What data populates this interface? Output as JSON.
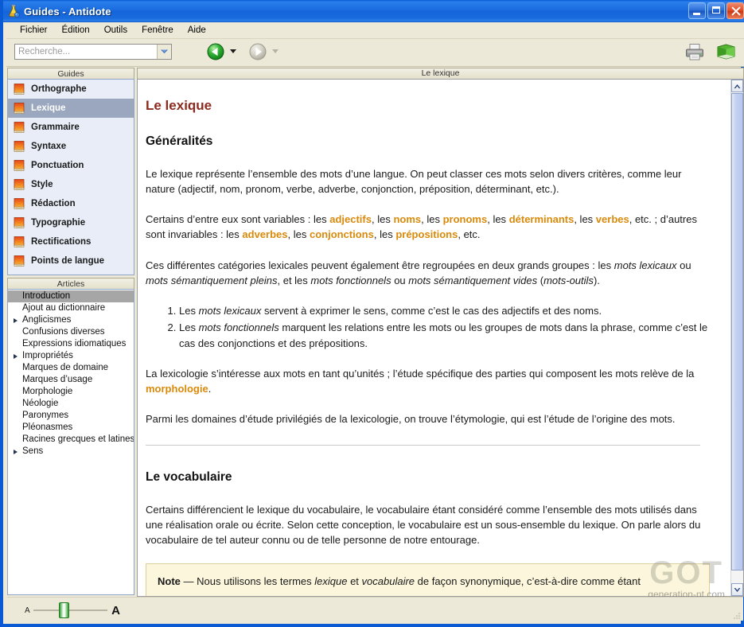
{
  "window": {
    "title": "Guides - Antidote",
    "app_icon": "flask-icon",
    "minimize_label": "Réduire",
    "maximize_label": "Agrandir",
    "close_label": "Fermer"
  },
  "menu": {
    "items": [
      {
        "label": "Fichier"
      },
      {
        "label": "Édition"
      },
      {
        "label": "Outils"
      },
      {
        "label": "Fenêtre"
      },
      {
        "label": "Aide"
      }
    ]
  },
  "toolbar": {
    "search": {
      "value": "",
      "placeholder": "Recherche..."
    },
    "back_icon": "green-back-arrow-icon",
    "forward_icon": "grey-forward-arrow-icon",
    "print_icon": "printer-icon",
    "dictionary_icon": "green-book-icon"
  },
  "sidebar": {
    "guides_header": "Guides",
    "guides": [
      {
        "label": "Orthographe",
        "selected": false
      },
      {
        "label": "Lexique",
        "selected": true
      },
      {
        "label": "Grammaire",
        "selected": false
      },
      {
        "label": "Syntaxe",
        "selected": false
      },
      {
        "label": "Ponctuation",
        "selected": false
      },
      {
        "label": "Style",
        "selected": false
      },
      {
        "label": "Rédaction",
        "selected": false
      },
      {
        "label": "Typographie",
        "selected": false
      },
      {
        "label": "Rectifications",
        "selected": false
      },
      {
        "label": "Points de langue",
        "selected": false
      }
    ],
    "articles_header": "Articles",
    "articles": [
      {
        "label": "Introduction",
        "selected": true,
        "expandable": false
      },
      {
        "label": "Ajout au dictionnaire",
        "selected": false,
        "expandable": false
      },
      {
        "label": "Anglicismes",
        "selected": false,
        "expandable": true
      },
      {
        "label": "Confusions diverses",
        "selected": false,
        "expandable": false
      },
      {
        "label": "Expressions idiomatiques",
        "selected": false,
        "expandable": false
      },
      {
        "label": "Impropriétés",
        "selected": false,
        "expandable": true
      },
      {
        "label": "Marques de domaine",
        "selected": false,
        "expandable": false
      },
      {
        "label": "Marques d’usage",
        "selected": false,
        "expandable": false
      },
      {
        "label": "Morphologie",
        "selected": false,
        "expandable": false
      },
      {
        "label": "Néologie",
        "selected": false,
        "expandable": false
      },
      {
        "label": "Paronymes",
        "selected": false,
        "expandable": false
      },
      {
        "label": "Pléonasmes",
        "selected": false,
        "expandable": false
      },
      {
        "label": "Racines grecques et latines",
        "selected": false,
        "expandable": false
      },
      {
        "label": "Sens",
        "selected": false,
        "expandable": true
      }
    ]
  },
  "content": {
    "tab_title": "Le lexique",
    "title": "Le lexique",
    "section1_heading": "Généralités",
    "p1": "Le lexique représente l’ensemble des mots d’une langue. On peut classer ces mots selon divers critères, comme leur nature (adjectif, nom, pronom, verbe,  adverbe, conjonction, préposition, déterminant, etc.).",
    "p2_parts": {
      "a": "Certains d’entre eux sont variables : les ",
      "kw1": "adjectifs",
      "b": ", les ",
      "kw2": "noms",
      "c": ", les ",
      "kw3": "pronoms",
      "d": ", les ",
      "kw4": "déterminants",
      "e": ", les ",
      "kw5": "verbes",
      "f": ", etc. ; d’autres sont invariables : les ",
      "kw6": "adverbes",
      "g": ", les ",
      "kw7": "conjonctions",
      "h": ", les ",
      "kw8": "prépositions",
      "i": ", etc."
    },
    "p3_parts": {
      "a": "Ces différentes catégories lexicales peuvent également être regroupées en deux grands groupes : les ",
      "i1": "mots lexicaux",
      "b": " ou ",
      "i2": "mots sémantiquement pleins",
      "c": ", et les ",
      "i3": "mots fonctionnels",
      "d": " ou ",
      "i4": "mots sémantiquement vides",
      "e": " (",
      "i5": "mots-outils",
      "f": ")."
    },
    "list": [
      {
        "pre": "Les ",
        "em": "mots lexicaux",
        "post": " servent à exprimer le sens, comme c’est le cas des adjectifs et des noms."
      },
      {
        "pre": "Les ",
        "em": "mots fonctionnels",
        "post": " marquent les relations entre les mots ou les groupes de mots dans la phrase, comme c’est le cas des conjonctions et des prépositions."
      }
    ],
    "p4_parts": {
      "a": "La lexicologie s’intéresse aux mots en tant qu’unités ; l’étude spécifique des parties qui composent les mots relève de la ",
      "kw": "morphologie",
      "b": "."
    },
    "p5": "Parmi les domaines d’étude privilégiés de la lexicologie, on trouve l’étymologie, qui est l’étude de l’origine des mots.",
    "section2_heading": "Le vocabulaire",
    "p6": "Certains différencient le lexique du vocabulaire, le vocabulaire étant considéré comme l’ensemble des mots utilisés dans une réalisation orale ou écrite. Selon cette conception, le vocabulaire est un sous-ensemble du lexique. On parle alors du vocabulaire de tel auteur connu ou de telle personne de notre entourage.",
    "note": {
      "label": "Note",
      "dash": " — ",
      "a": "Nous utilisons les termes ",
      "i1": "lexique",
      "b": " et ",
      "i2": "vocabulaire",
      "c": " de façon synonymique, c’est-à-dire comme étant"
    }
  },
  "statusbar": {
    "zoom_small_label": "A",
    "zoom_large_label": "A"
  },
  "watermark": {
    "logo": "GOT",
    "site": "generation-nt.com"
  },
  "colors": {
    "titlebar_blue": "#1564DB",
    "accent_orange": "#D98A0B",
    "heading_red": "#8C2A1E",
    "chrome_beige": "#ECE9D8",
    "selection_grey": "#9AA7BE",
    "note_yellow": "#FBF6DC"
  }
}
